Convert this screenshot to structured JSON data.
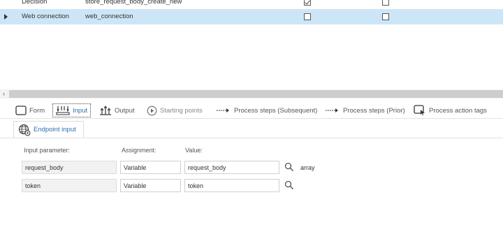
{
  "grid": {
    "rows": [
      {
        "name": "Decision",
        "id": "store_request_body_create_new",
        "col1_checked": true,
        "col2_checked": false,
        "selected": false
      },
      {
        "name": "Web connection",
        "id": "web_connection",
        "col1_checked": false,
        "col2_checked": false,
        "selected": true
      }
    ],
    "selected_bg": "#cde6f7"
  },
  "scrollbar": {
    "left_arrow": "‹"
  },
  "tabs": [
    {
      "label": "Form",
      "icon": "form-icon"
    },
    {
      "label": "Input",
      "icon": "input-icon",
      "active": true
    },
    {
      "label": "Output",
      "icon": "output-icon"
    },
    {
      "label": "Starting points",
      "icon": "play-circle-icon",
      "dim": true
    },
    {
      "label": "Process steps (Subsequent)",
      "icon": "dotted-arrow-icon"
    },
    {
      "label": "Process steps (Prior)",
      "icon": "dotted-arrow-icon"
    },
    {
      "label": "Process action tags",
      "icon": "tag-pointer-icon"
    }
  ],
  "subtab": {
    "label": "Endpoint input",
    "icon": "globe-gear-icon"
  },
  "params": {
    "headers": {
      "param": "Input parameter:",
      "assign": "Assignment:",
      "value": "Value:"
    },
    "rows": [
      {
        "param": "request_body",
        "assign": "Variable",
        "value": "request_body",
        "type": "array"
      },
      {
        "param": "token",
        "assign": "Variable",
        "value": "token",
        "type": ""
      }
    ]
  }
}
